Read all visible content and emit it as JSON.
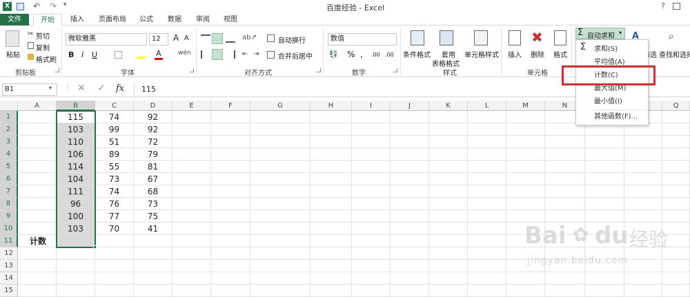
{
  "titlebar": {
    "title": "百度经验 - Excel",
    "help": "?"
  },
  "tabs": [
    "文件",
    "开始",
    "插入",
    "页面布局",
    "公式",
    "数据",
    "审阅",
    "视图"
  ],
  "ribbon": {
    "clipboard": {
      "paste": "粘贴",
      "cut": "剪切",
      "copy": "复制",
      "format_painter": "格式刷",
      "label": "剪贴板"
    },
    "font": {
      "name": "微软雅黑",
      "size": "12",
      "bold": "B",
      "italic": "I",
      "underline": "U",
      "label": "字体",
      "grow": "A",
      "shrink": "A",
      "font_color": "A"
    },
    "align": {
      "wrap": "自动换行",
      "merge": "合并后居中",
      "label": "对齐方式"
    },
    "number": {
      "format": "数值",
      "percent": "%",
      "comma": ",",
      "inc": ".00",
      "dec": ".00",
      "label": "数字"
    },
    "styles": {
      "cond": "条件格式",
      "table1": "套用",
      "table2": "表格格式",
      "cell": "单元格样式",
      "label": "样式"
    },
    "cells": {
      "insert": "插入",
      "delete": "删除",
      "format": "格式",
      "label": "单元格"
    },
    "editing": {
      "autosum": "自动求和",
      "sort": "筛选",
      "find": "查找和选择"
    }
  },
  "formula_bar": {
    "name_box": "B1",
    "fx": "fx",
    "value": "115"
  },
  "grid": {
    "columns": [
      "A",
      "B",
      "C",
      "D",
      "E",
      "F",
      "G",
      "H",
      "I",
      "J",
      "K",
      "L",
      "M",
      "N",
      "O",
      "P",
      "Q"
    ],
    "rows": [
      "1",
      "2",
      "3",
      "4",
      "5",
      "6",
      "7",
      "8",
      "9",
      "10",
      "11",
      "12",
      "13",
      "14",
      "15"
    ],
    "col_b": [
      "115",
      "103",
      "110",
      "106",
      "114",
      "104",
      "111",
      "96",
      "100",
      "103"
    ],
    "col_c": [
      "74",
      "99",
      "51",
      "89",
      "55",
      "73",
      "74",
      "76",
      "77",
      "70"
    ],
    "col_d": [
      "92",
      "92",
      "72",
      "79",
      "81",
      "67",
      "68",
      "73",
      "75",
      "41"
    ],
    "a11": "计数"
  },
  "menu": {
    "items": [
      "求和(S)",
      "平均值(A)",
      "计数(C)",
      "最大值(M)",
      "最小值(I)",
      "其他函数(F)..."
    ],
    "sigma": "Σ"
  },
  "watermark": {
    "brand": "Bai",
    "brand2": "du",
    "cn": "经验",
    "url": "jingyan.baidu.com"
  },
  "colors": {
    "excel_green": "#217346",
    "selection_gray": "#d9d9d9",
    "highlight_red": "#e0282e"
  }
}
